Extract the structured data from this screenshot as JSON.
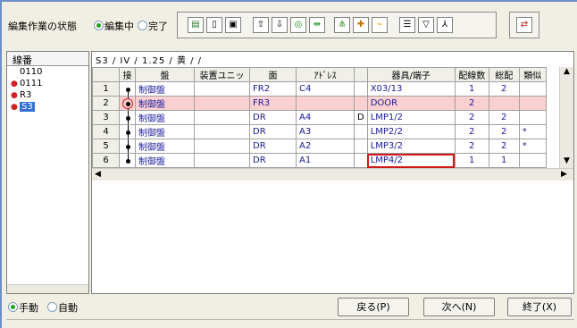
{
  "status_label": "編集作業の状態",
  "mode_options": [
    {
      "label": "編集中",
      "checked": true
    },
    {
      "label": "完了",
      "checked": false
    }
  ],
  "toolbar": {
    "icons": [
      "page-icon",
      "doc-icon",
      "save-icon",
      "up-arrow-icon",
      "down-arrow-icon",
      "target-icon",
      "split-icon",
      "branch-icon",
      "cross-icon",
      "wand-icon",
      "list-icon",
      "filter-icon",
      "merge-icon"
    ],
    "extra_icon": "swap-icon"
  },
  "left_panel": {
    "header": "線番",
    "items": [
      {
        "mark": "",
        "label": "0110"
      },
      {
        "mark": "●",
        "label": "0111"
      },
      {
        "mark": "●",
        "label": "R3"
      },
      {
        "mark": "●",
        "label": "S3",
        "selected": true
      }
    ]
  },
  "breadcrumb": "S3 / IV / 1.25 / 黄 /  /",
  "table": {
    "headers": [
      "",
      "接",
      "盤",
      "装置ユニッ",
      "面",
      "ｱﾄﾞﾚｽ",
      "",
      "器具/端子",
      "配線数",
      "総配",
      "類似"
    ],
    "rows": [
      {
        "no": "1",
        "ban": "制御盤",
        "unit": "",
        "face": "FR2",
        "addr": "C4",
        "d": "",
        "dev": "X03/13",
        "count": "1",
        "total": "2",
        "sim": ""
      },
      {
        "no": "2",
        "ban": "制御盤",
        "unit": "",
        "face": "FR3",
        "addr": "",
        "d": "",
        "dev": "DOOR",
        "count": "2",
        "total": "",
        "sim": "",
        "highlight": true
      },
      {
        "no": "3",
        "ban": "制御盤",
        "unit": "",
        "face": "DR",
        "addr": "A4",
        "d": "D",
        "dev": "LMP1/2",
        "count": "2",
        "total": "2",
        "sim": ""
      },
      {
        "no": "4",
        "ban": "制御盤",
        "unit": "",
        "face": "DR",
        "addr": "A3",
        "d": "",
        "dev": "LMP2/2",
        "count": "2",
        "total": "2",
        "sim": "*"
      },
      {
        "no": "5",
        "ban": "制御盤",
        "unit": "",
        "face": "DR",
        "addr": "A2",
        "d": "",
        "dev": "LMP3/2",
        "count": "2",
        "total": "2",
        "sim": "*"
      },
      {
        "no": "6",
        "ban": "制御盤",
        "unit": "",
        "face": "DR",
        "addr": "A1",
        "d": "",
        "dev": "LMP4/2",
        "count": "1",
        "total": "1",
        "sim": "",
        "selected_cell": true
      }
    ]
  },
  "bottom": {
    "manual": "手動",
    "auto": "自動",
    "back": "戻る(P)",
    "next": "次へ(N)",
    "end": "終了(X)"
  }
}
